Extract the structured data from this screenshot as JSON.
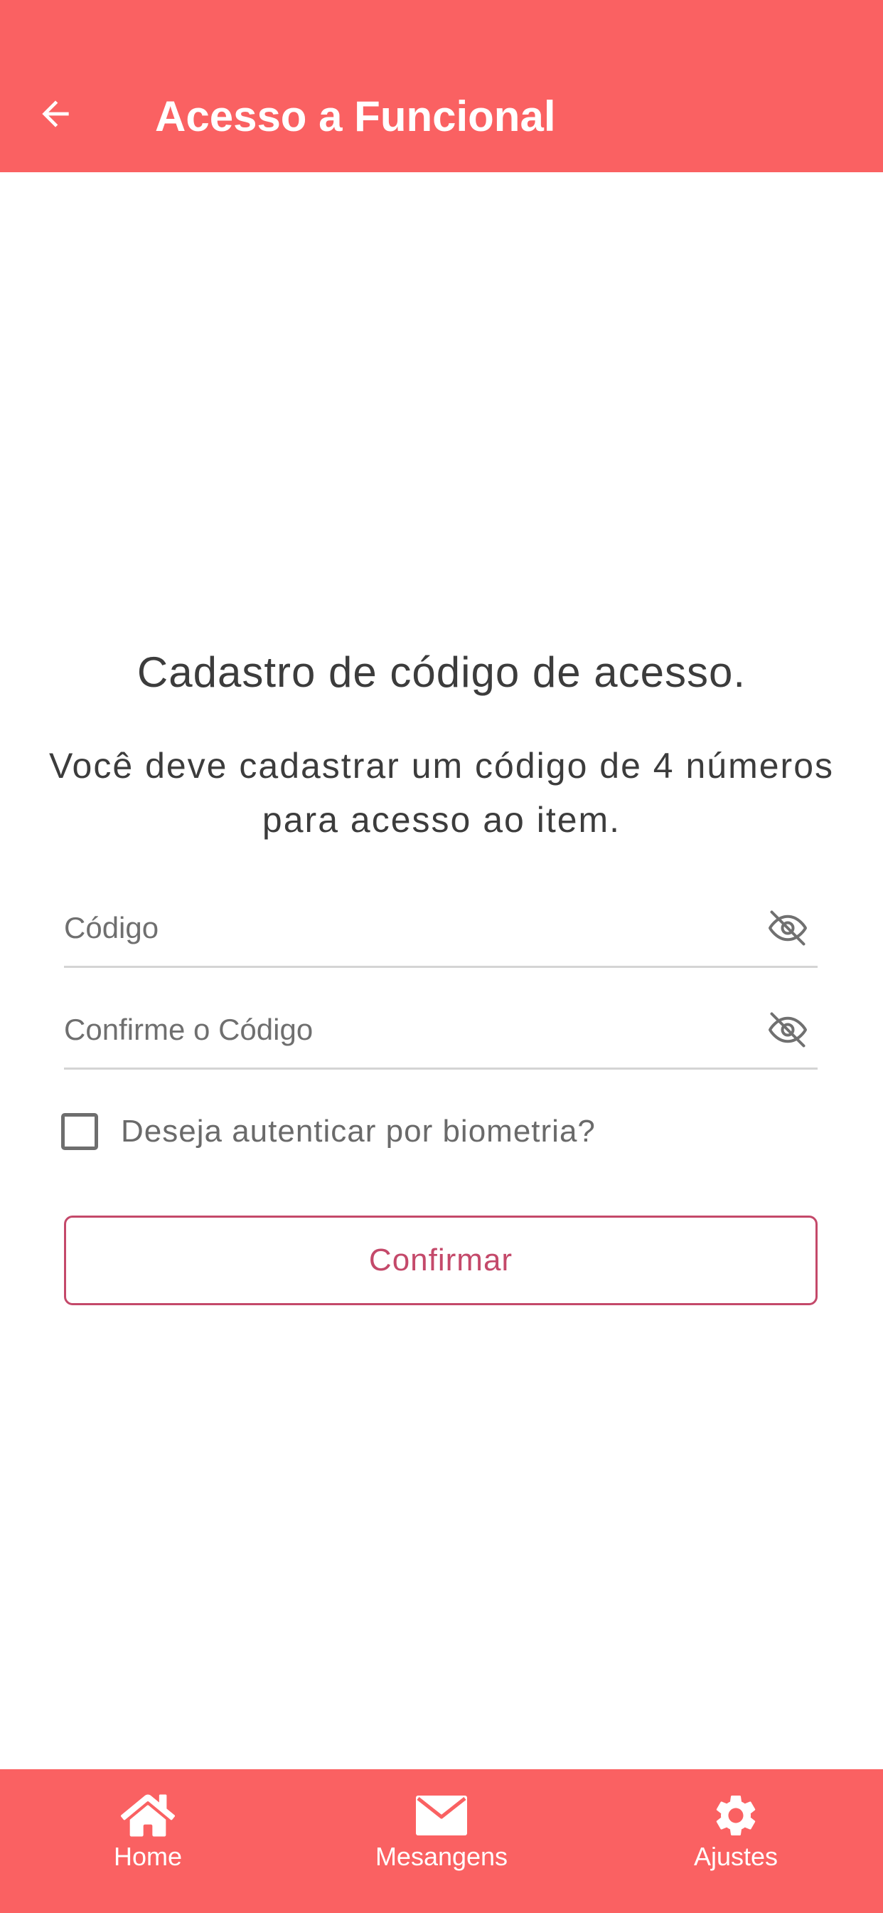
{
  "colors": {
    "primary": "#fa6162",
    "accent": "#c4496a",
    "on_primary": "#ffffff",
    "divider": "#d4d4d4"
  },
  "app_bar": {
    "title": "Acesso a Funcional",
    "back_icon": "arrow-left-icon"
  },
  "main": {
    "heading": "Cadastro de código de acesso.",
    "description_line1": "Você deve cadastrar um código de 4 números",
    "description_line2": "para acesso ao item.",
    "code_field": {
      "placeholder": "Código",
      "value": "",
      "icon": "eye-off-icon"
    },
    "confirm_field": {
      "placeholder": "Confirme o Código",
      "value": "",
      "icon": "eye-off-icon"
    },
    "biometric": {
      "label": "Deseja autenticar por biometria?",
      "checked": false
    },
    "confirm_button": "Confirmar"
  },
  "bottom_nav": {
    "items": [
      {
        "label": "Home",
        "icon": "home-icon"
      },
      {
        "label": "Mesangens",
        "icon": "mail-icon"
      },
      {
        "label": "Ajustes",
        "icon": "gear-icon"
      }
    ]
  }
}
